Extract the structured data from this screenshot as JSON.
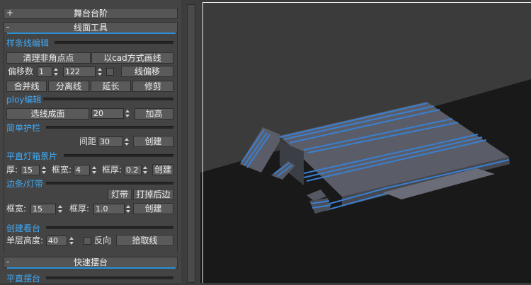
{
  "panel": {
    "rollout1": {
      "sign": "+",
      "title": "舞台台阶"
    },
    "rollout2": {
      "sign": "-",
      "title": "线面工具"
    },
    "spline": {
      "section": "样条线编辑",
      "clean_btn": "清理非角点点",
      "cad_btn": "以cad方式画线",
      "offset_label": "偏移数",
      "offset_val1": "1",
      "offset_val2": "122",
      "offset_btn": "线偏移",
      "merge_btn": "合并线",
      "split_btn": "分离线",
      "extend_btn": "延长",
      "trim_btn": "修剪"
    },
    "poly": {
      "section": "ploy编辑",
      "select_btn": "选线成面",
      "value": "20",
      "raise_btn": "加高"
    },
    "rail": {
      "section": "简单护栏",
      "spacing_label": "间距",
      "spacing_val": "30",
      "create_btn": "创建"
    },
    "lightbox": {
      "section": "平直灯箱景片",
      "thick_label": "厚:",
      "thick_val": "15",
      "fw_label": "框宽:",
      "fw_val": "4",
      "ft_label": "框厚:",
      "ft_val": "0.2",
      "create_btn": "创建"
    },
    "strip": {
      "section": "边条/灯带",
      "lamp_btn": "灯带",
      "edge_btn": "打掉后边",
      "fw_label": "框宽:",
      "fw_val": "15",
      "ft_label": "框厚:",
      "ft_val": "1.0",
      "create_btn": "创建"
    },
    "stand": {
      "section": "创建看台",
      "height_label": "单层高度:",
      "height_val": "40",
      "reverse_label": "反向",
      "pick_btn": "拾取线"
    },
    "rollout3": {
      "sign": "-",
      "title": "快速摆台"
    },
    "flat": {
      "section": "平直摆台"
    }
  },
  "colors": {
    "accent": "#2a90d8",
    "section_text": "#3fa9f5",
    "stair_blue": "#3a7fd0",
    "stage_gray": "#595c66"
  }
}
